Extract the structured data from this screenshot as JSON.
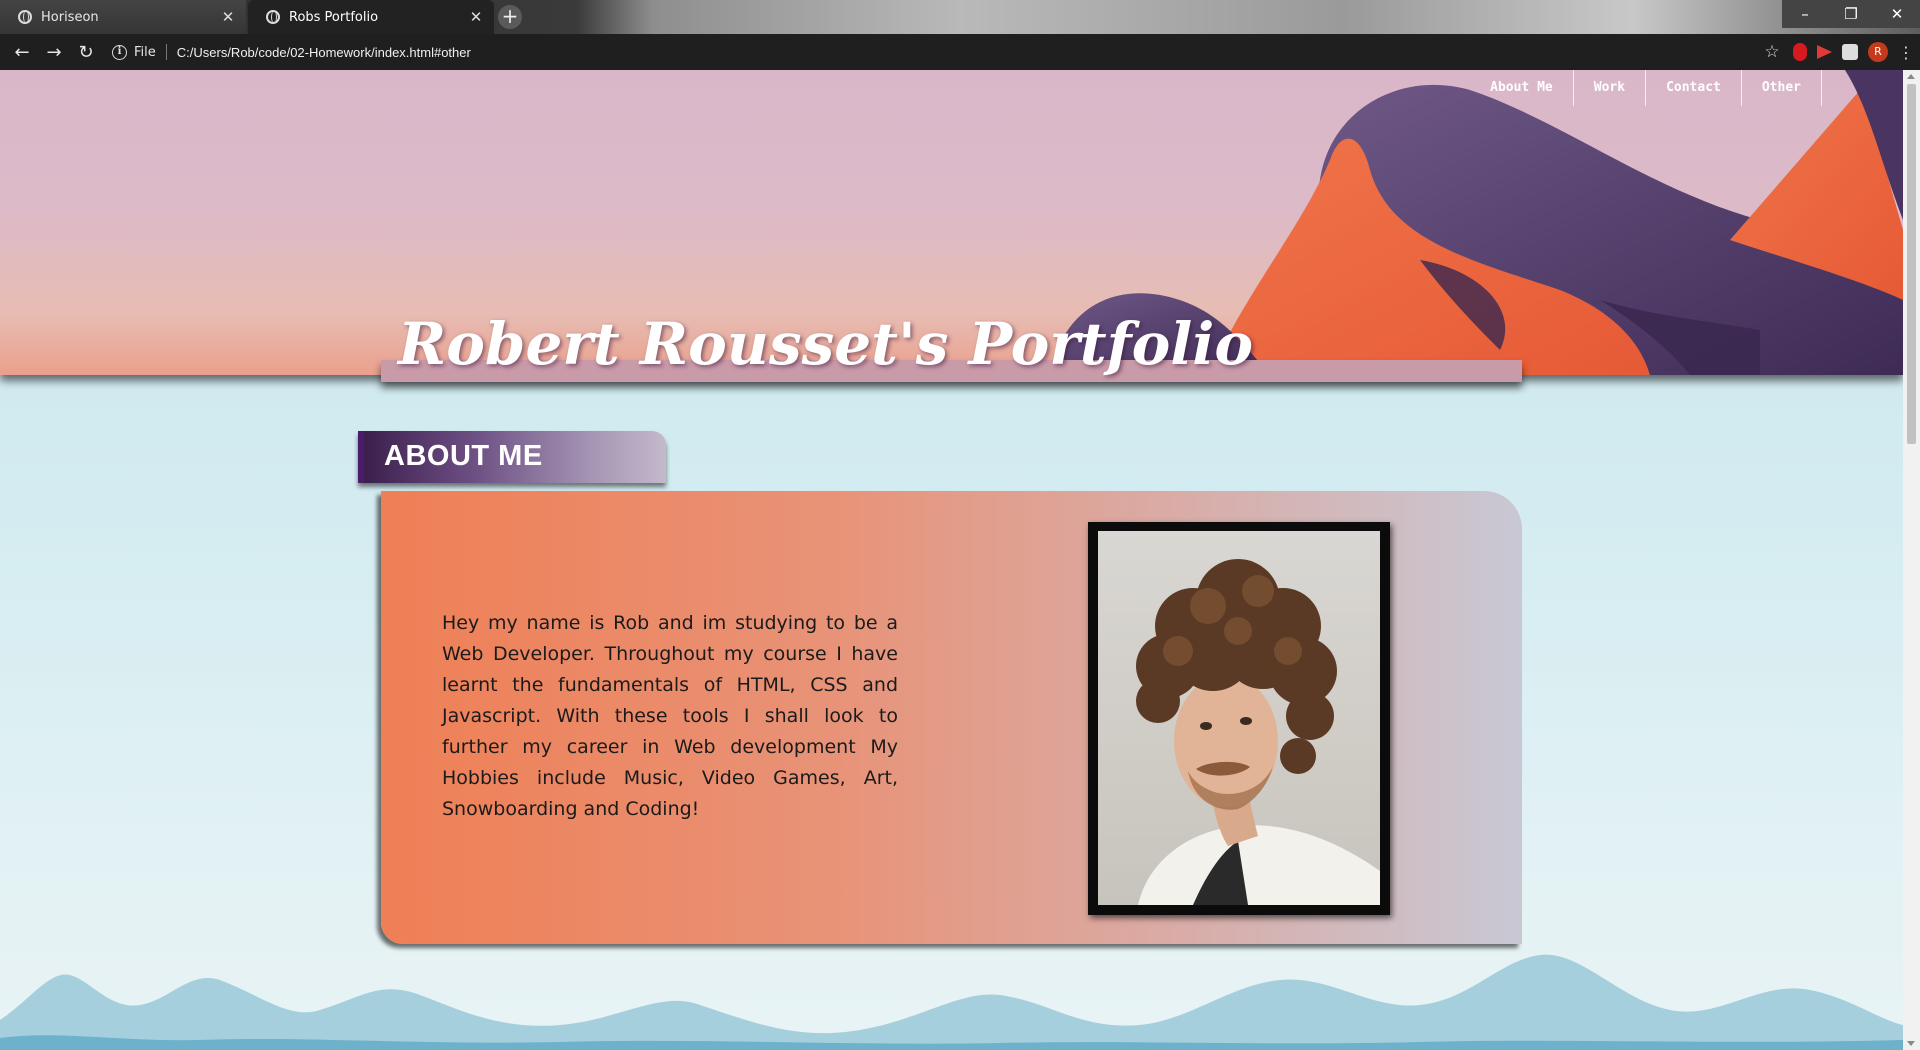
{
  "browser": {
    "tabs": [
      {
        "title": "Horiseon",
        "active": false
      },
      {
        "title": "Robs Portfolio",
        "active": true
      }
    ],
    "new_tab_symbol": "+",
    "close_symbol": "✕",
    "address": {
      "scheme_label": "File",
      "url": "C:/Users/Rob/code/02-Homework/index.html#other"
    },
    "nav_icons": {
      "back": "←",
      "forward": "→",
      "reload": "↻"
    },
    "profile_initial": "R",
    "window_controls": {
      "minimize": "–",
      "maximize": "❐",
      "close": "✕"
    }
  },
  "header": {
    "nav": [
      "About Me",
      "Work",
      "Contact",
      "Other"
    ],
    "title": "Robert Rousset's Portfolio"
  },
  "about": {
    "heading": "ABOUT ME",
    "text": "Hey my name is Rob and im studying to be a Web Developer. Throughout my course I have learnt the fundamentals of HTML, CSS and Javascript. With these tools I shall look to further my career in Web development My Hobbies include Music, Video Games, Art, Snowboarding and Coding!"
  },
  "colors": {
    "accent_purple": "#4a1d6b",
    "card_orange": "#ef7f55",
    "banner_orange": "#ec6a42",
    "banner_purple": "#5e4775"
  }
}
